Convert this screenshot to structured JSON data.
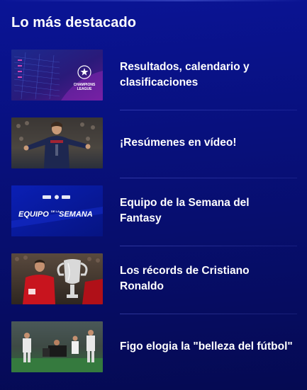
{
  "section": {
    "title": "Lo más destacado"
  },
  "items": [
    {
      "label": "Resultados, calendario y clasificaciones",
      "thumb_icon": "champions-league-icon",
      "thumb_text": "CHAMPIONS LEAGUE"
    },
    {
      "label": "¡Resúmenes en vídeo!",
      "thumb_icon": "player-photo"
    },
    {
      "label": "Equipo de la Semana del Fantasy",
      "thumb_icon": "team-of-the-week-graphic",
      "thumb_text": "EQUIPO DE LA SEMANA"
    },
    {
      "label": "Los récords de Cristiano Ronaldo",
      "thumb_icon": "trophy-photo"
    },
    {
      "label": "Figo elogia la \"belleza del fútbol\"",
      "thumb_icon": "match-photo"
    }
  ],
  "colors": {
    "background_top": "#0a1496",
    "background_bottom": "#050a52",
    "text": "#ffffff"
  }
}
